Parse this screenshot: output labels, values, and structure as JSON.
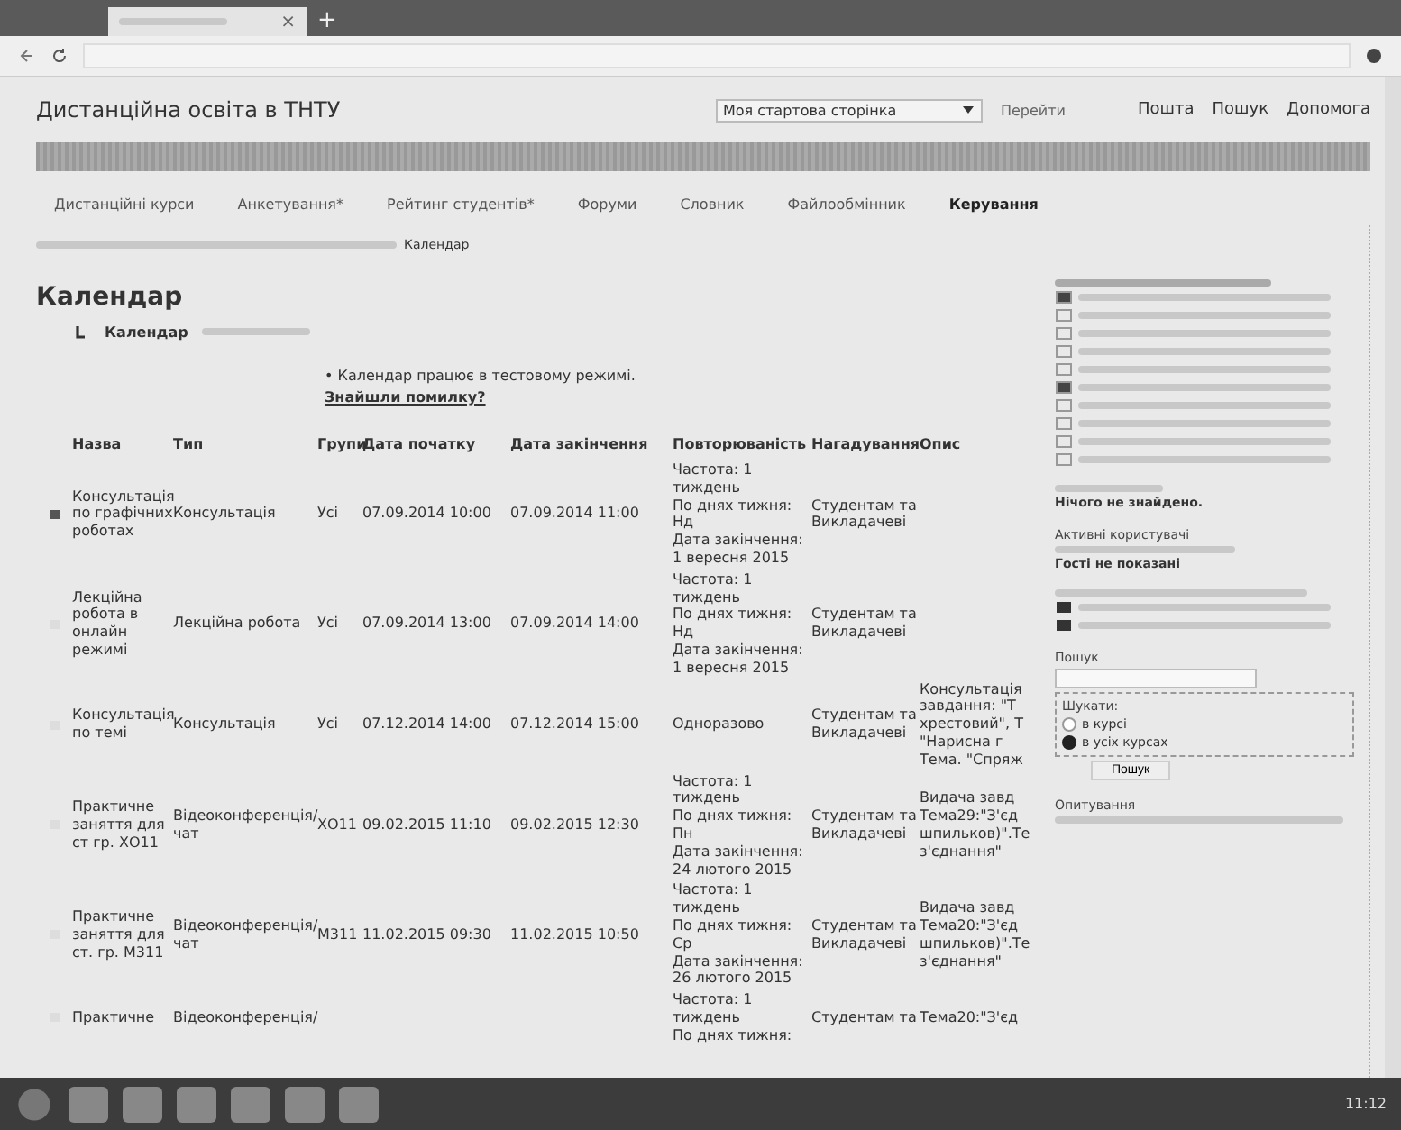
{
  "browser": {
    "tab_close": "×",
    "new_tab": "+"
  },
  "header": {
    "site_title": "Дистанційна освіта в ТНТУ",
    "start_select": "Моя стартова сторінка",
    "go_button": "Перейти",
    "links": [
      "Пошта",
      "Пошук",
      "Допомога"
    ]
  },
  "nav": [
    {
      "label": "Дистанційні курси",
      "selected": false
    },
    {
      "label": "Анкетування*",
      "selected": false
    },
    {
      "label": "Рейтинг студентів*",
      "selected": false
    },
    {
      "label": "Форуми",
      "selected": false
    },
    {
      "label": "Словник",
      "selected": false
    },
    {
      "label": "Файлообмінник",
      "selected": false
    },
    {
      "label": "Керування",
      "selected": true
    }
  ],
  "breadcrumb_current": "Календар",
  "page_title": "Календар",
  "subtab": "Календар",
  "notice": {
    "text": "• Календар працює в тестовому режимі.",
    "link": "Знайшли помилку?"
  },
  "table": {
    "columns": [
      "Назва",
      "Тип",
      "Групи",
      "Дата початку",
      "Дата закінчення",
      "Повторюваність",
      "Нагадування",
      "Опис"
    ],
    "rows": [
      {
        "selected": true,
        "name": "Консультація по графічних роботах",
        "type": "Консультація",
        "groups": "Усі",
        "start": "07.09.2014 10:00",
        "end": "07.09.2014 11:00",
        "repeat": [
          "Частота: 1",
          "тиждень",
          "По днях тижня:",
          "Нд",
          "Дата закінчення:",
          "1 вересня 2015"
        ],
        "notify": [
          "Студентам та",
          "Викладачеві"
        ],
        "desc": []
      },
      {
        "selected": false,
        "name": "Лекційна робота в онлайн режимі",
        "type": "Лекційна робота",
        "groups": "Усі",
        "start": "07.09.2014 13:00",
        "end": "07.09.2014 14:00",
        "repeat": [
          "Частота: 1",
          "тиждень",
          "По днях тижня:",
          "Нд",
          "Дата закінчення:",
          "1 вересня 2015"
        ],
        "notify": [
          "Студентам та",
          "Викладачеві"
        ],
        "desc": []
      },
      {
        "selected": false,
        "name": "Консультація по темі",
        "type": "Консультація",
        "groups": "Усі",
        "start": "07.12.2014 14:00",
        "end": "07.12.2014 15:00",
        "repeat": [
          "Одноразово"
        ],
        "notify": [
          "Студентам та",
          "Викладачеві"
        ],
        "desc": [
          "Консультація",
          "завдання: \"Т",
          "хрестовий\", Т",
          "\"Нарисна г",
          "Тема. \"Спряж"
        ]
      },
      {
        "selected": false,
        "name": "Практичне заняття для ст гр. ХО11",
        "type": "Відеоконференція/чат",
        "groups": "ХО11",
        "start": "09.02.2015 11:10",
        "end": "09.02.2015 12:30",
        "repeat": [
          "Частота: 1",
          "тиждень",
          "По днях тижня:",
          "Пн",
          "Дата закінчення:",
          "24 лютого 2015"
        ],
        "notify": [
          "Студентам та",
          "Викладачеві"
        ],
        "desc": [
          "Видача завд",
          "Тема29:\"З'єд",
          "шпильков)\".Те",
          "з'єднання\""
        ]
      },
      {
        "selected": false,
        "name": "Практичне заняття для ст. гр. М311",
        "type": "Відеоконференція/чат",
        "groups": "М311",
        "start": "11.02.2015 09:30",
        "end": "11.02.2015 10:50",
        "repeat": [
          "Частота: 1",
          "тиждень",
          "По днях тижня:",
          "Ср",
          "Дата закінчення:",
          "26 лютого 2015"
        ],
        "notify": [
          "Студентам та",
          "Викладачеві"
        ],
        "desc": [
          "Видача завд",
          "Тема20:\"З'єд",
          "шпильков)\".Те",
          "з'єднання\""
        ]
      },
      {
        "selected": false,
        "name": "Практичне",
        "type": "Відеоконференція/",
        "groups": "",
        "start": "",
        "end": "",
        "repeat": [
          "Частота: 1",
          "тиждень",
          "По днях тижня:"
        ],
        "notify": [
          "Студентам та"
        ],
        "desc": [
          "Тема20:\"З'єд"
        ]
      }
    ]
  },
  "sidebar": {
    "events_empty": "Нічого не знайдено.",
    "online_title": "Активні користувачі",
    "online_guests": "Гості не показані",
    "search_title": "Пошук",
    "search_scope_label": "Шукати:",
    "scopes": [
      {
        "label": "в курсі",
        "selected": false
      },
      {
        "label": "в усіх курсах",
        "selected": true
      }
    ],
    "search_button": "Пошук",
    "poll_title": "Опитування"
  },
  "taskbar": {
    "time": "11:12"
  }
}
